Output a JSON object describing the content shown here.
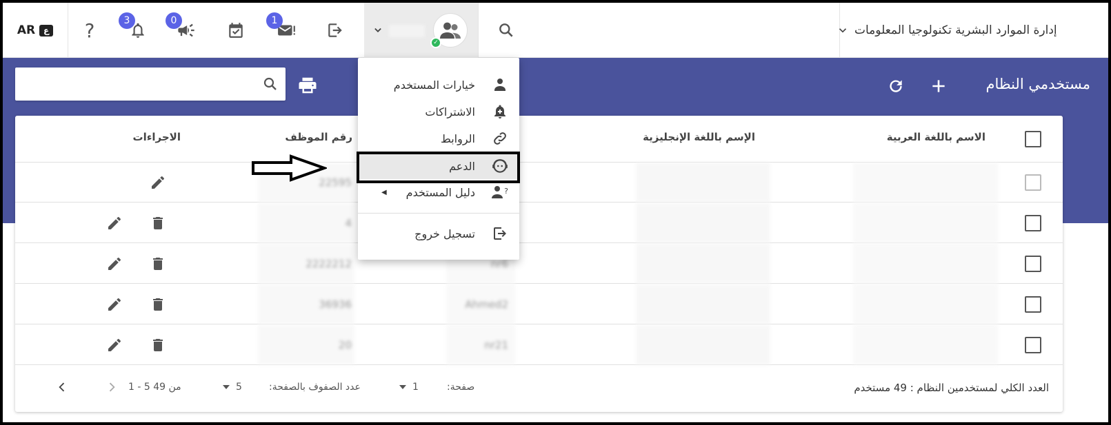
{
  "topbar": {
    "lang_label": "AR",
    "lang_badge": "ع",
    "notification_count": "3",
    "announcement_count": "0",
    "message_count": "1",
    "org_name": "إدارة الموارد البشرية تكنولوجيا المعلومات"
  },
  "header": {
    "title": "مستخدمي النظام",
    "search_placeholder": ""
  },
  "table": {
    "columns": {
      "arabic_name": "الاسم باللغة العربية",
      "english_name": "الإسم باللغة الإنجليزية",
      "employee_no": "رقم الموظف",
      "actions": "الاجراءات"
    },
    "rows": [
      {
        "employee_no": "22595",
        "username": "",
        "english_name": "",
        "arabic_name": ""
      },
      {
        "employee_no": "4",
        "username": "",
        "english_name": "",
        "arabic_name": ""
      },
      {
        "employee_no": "2222212",
        "username": "nr6",
        "english_name": "",
        "arabic_name": ""
      },
      {
        "employee_no": "36936",
        "username": "Ahmed2",
        "english_name": "",
        "arabic_name": ""
      },
      {
        "employee_no": "20",
        "username": "nr21",
        "english_name": "",
        "arabic_name": ""
      }
    ]
  },
  "footer": {
    "total_label": "العدد الكلي لمستخدمين النظام : 49 مستخدم",
    "page_label": "صفحة:",
    "page_value": "1",
    "rows_label": "عدد الصفوف بالصفحة:",
    "rows_value": "5",
    "range_label": "1 - 5 من 49"
  },
  "user_menu": {
    "items": [
      {
        "label": "خيارات المستخدم",
        "icon": "person-icon"
      },
      {
        "label": "الاشتراكات",
        "icon": "bell-plus-icon"
      },
      {
        "label": "الروابط",
        "icon": "link-icon"
      },
      {
        "label": "الدعم",
        "icon": "support-agent-icon"
      },
      {
        "label": "دليل المستخدم",
        "icon": "person-help-icon"
      },
      {
        "label": "تسجيل خروج",
        "icon": "logout-icon"
      }
    ]
  },
  "colors": {
    "header_blue": "#4a539c",
    "badge_blue": "#5b63e6",
    "status_green": "#2eb85c"
  }
}
